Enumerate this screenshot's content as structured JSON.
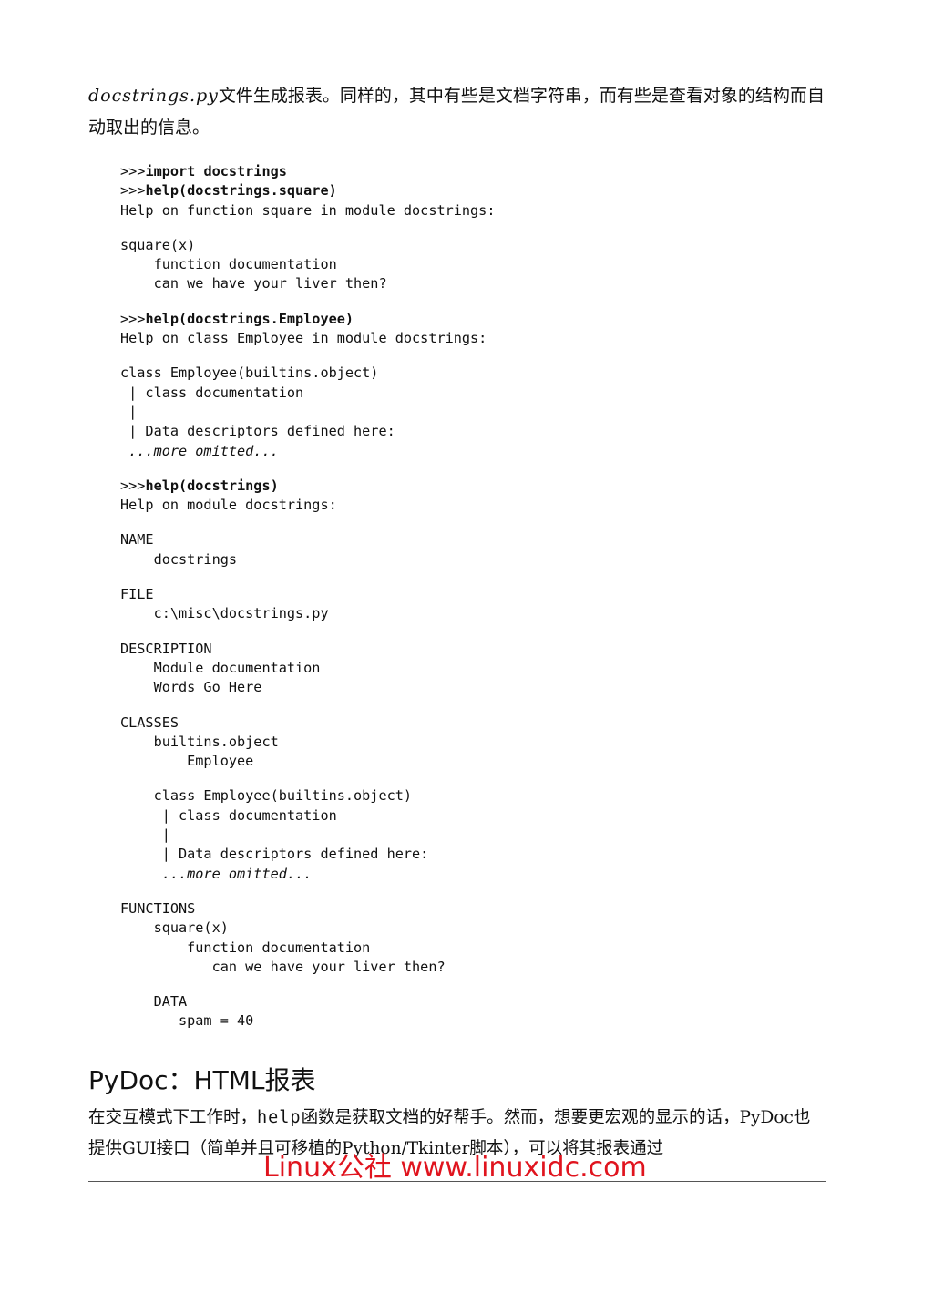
{
  "intro": {
    "filename": "docstrings.py",
    "text": "文件生成报表。同样的，其中有些是文档字符串，而有些是查看对象的结构而自动取出的信息。"
  },
  "code": {
    "cmd1_prompt": ">>>",
    "cmd1": "import docstrings",
    "cmd2_prompt": ">>>",
    "cmd2": "help(docstrings.square)",
    "out2_header": "Help on function square in module docstrings:",
    "square_sig": "square(x)",
    "square_doc1": "    function documentation",
    "square_doc2": "    can we have your liver then?",
    "cmd3_prompt": ">>>",
    "cmd3": "help(docstrings.Employee)",
    "out3_header": "Help on class Employee in module docstrings:",
    "emp_sig": "class Employee(builtins.object)",
    "emp_doc1": " | class documentation",
    "emp_doc2": " |",
    "emp_doc3": " | Data descriptors defined here:",
    "emp_more": " ...more omitted...",
    "cmd4_prompt": ">>>",
    "cmd4": "help(docstrings)",
    "out4_header": "Help on module docstrings:",
    "name_h": "NAME",
    "name_v": "    docstrings",
    "file_h": "FILE",
    "file_v": "    c:\\misc\\docstrings.py",
    "desc_h": "DESCRIPTION",
    "desc_v1": "    Module documentation",
    "desc_v2": "    Words Go Here",
    "classes_h": "CLASSES",
    "classes_v1": "    builtins.object",
    "classes_v2": "        Employee",
    "cls_sig": "    class Employee(builtins.object)",
    "cls_doc1": "     | class documentation",
    "cls_doc2": "     |",
    "cls_doc3": "     | Data descriptors defined here:",
    "cls_more": "     ...more omitted...",
    "func_h": "FUNCTIONS",
    "func_v1": "    square(x)",
    "func_v2": "        function documentation",
    "func_v3": "           can we have your liver then?",
    "data_h": "    DATA",
    "data_v": "       spam = 40"
  },
  "section": {
    "title": "PyDoc：HTML报表"
  },
  "para": {
    "part1": "在交互模式下工作时，",
    "help_word": "help",
    "part2": "函数是获取文档的好帮手。然而，想要更宏观的显示的话，",
    "pydoc_word": "PyDoc",
    "part3": "也提供GUI接口（简单并且可移植的Python/Tkinter脚本），可以将其报表通过"
  },
  "watermark": {
    "text": "Linux公社 www.linuxidc.com"
  }
}
